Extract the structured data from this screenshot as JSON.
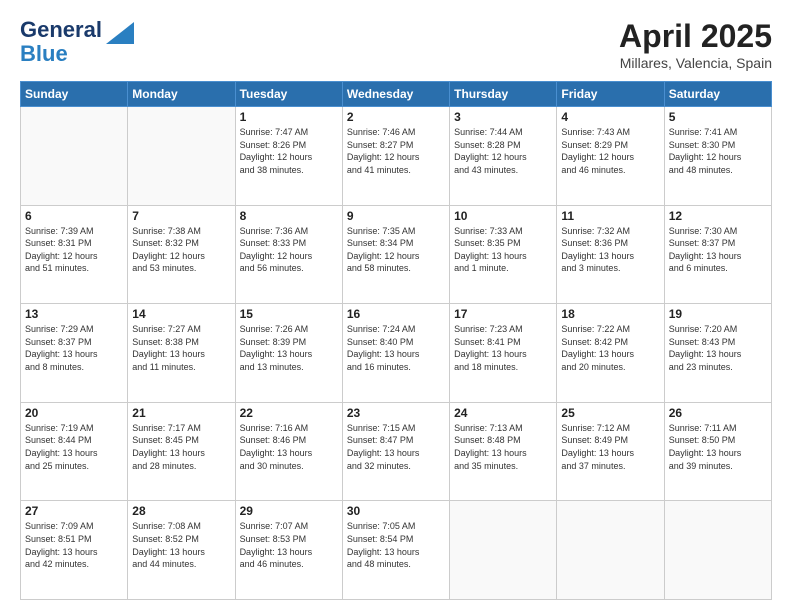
{
  "header": {
    "logo_line1": "General",
    "logo_line2": "Blue",
    "month_title": "April 2025",
    "location": "Millares, Valencia, Spain"
  },
  "weekdays": [
    "Sunday",
    "Monday",
    "Tuesday",
    "Wednesday",
    "Thursday",
    "Friday",
    "Saturday"
  ],
  "weeks": [
    [
      {
        "day": "",
        "info": ""
      },
      {
        "day": "",
        "info": ""
      },
      {
        "day": "1",
        "info": "Sunrise: 7:47 AM\nSunset: 8:26 PM\nDaylight: 12 hours\nand 38 minutes."
      },
      {
        "day": "2",
        "info": "Sunrise: 7:46 AM\nSunset: 8:27 PM\nDaylight: 12 hours\nand 41 minutes."
      },
      {
        "day": "3",
        "info": "Sunrise: 7:44 AM\nSunset: 8:28 PM\nDaylight: 12 hours\nand 43 minutes."
      },
      {
        "day": "4",
        "info": "Sunrise: 7:43 AM\nSunset: 8:29 PM\nDaylight: 12 hours\nand 46 minutes."
      },
      {
        "day": "5",
        "info": "Sunrise: 7:41 AM\nSunset: 8:30 PM\nDaylight: 12 hours\nand 48 minutes."
      }
    ],
    [
      {
        "day": "6",
        "info": "Sunrise: 7:39 AM\nSunset: 8:31 PM\nDaylight: 12 hours\nand 51 minutes."
      },
      {
        "day": "7",
        "info": "Sunrise: 7:38 AM\nSunset: 8:32 PM\nDaylight: 12 hours\nand 53 minutes."
      },
      {
        "day": "8",
        "info": "Sunrise: 7:36 AM\nSunset: 8:33 PM\nDaylight: 12 hours\nand 56 minutes."
      },
      {
        "day": "9",
        "info": "Sunrise: 7:35 AM\nSunset: 8:34 PM\nDaylight: 12 hours\nand 58 minutes."
      },
      {
        "day": "10",
        "info": "Sunrise: 7:33 AM\nSunset: 8:35 PM\nDaylight: 13 hours\nand 1 minute."
      },
      {
        "day": "11",
        "info": "Sunrise: 7:32 AM\nSunset: 8:36 PM\nDaylight: 13 hours\nand 3 minutes."
      },
      {
        "day": "12",
        "info": "Sunrise: 7:30 AM\nSunset: 8:37 PM\nDaylight: 13 hours\nand 6 minutes."
      }
    ],
    [
      {
        "day": "13",
        "info": "Sunrise: 7:29 AM\nSunset: 8:37 PM\nDaylight: 13 hours\nand 8 minutes."
      },
      {
        "day": "14",
        "info": "Sunrise: 7:27 AM\nSunset: 8:38 PM\nDaylight: 13 hours\nand 11 minutes."
      },
      {
        "day": "15",
        "info": "Sunrise: 7:26 AM\nSunset: 8:39 PM\nDaylight: 13 hours\nand 13 minutes."
      },
      {
        "day": "16",
        "info": "Sunrise: 7:24 AM\nSunset: 8:40 PM\nDaylight: 13 hours\nand 16 minutes."
      },
      {
        "day": "17",
        "info": "Sunrise: 7:23 AM\nSunset: 8:41 PM\nDaylight: 13 hours\nand 18 minutes."
      },
      {
        "day": "18",
        "info": "Sunrise: 7:22 AM\nSunset: 8:42 PM\nDaylight: 13 hours\nand 20 minutes."
      },
      {
        "day": "19",
        "info": "Sunrise: 7:20 AM\nSunset: 8:43 PM\nDaylight: 13 hours\nand 23 minutes."
      }
    ],
    [
      {
        "day": "20",
        "info": "Sunrise: 7:19 AM\nSunset: 8:44 PM\nDaylight: 13 hours\nand 25 minutes."
      },
      {
        "day": "21",
        "info": "Sunrise: 7:17 AM\nSunset: 8:45 PM\nDaylight: 13 hours\nand 28 minutes."
      },
      {
        "day": "22",
        "info": "Sunrise: 7:16 AM\nSunset: 8:46 PM\nDaylight: 13 hours\nand 30 minutes."
      },
      {
        "day": "23",
        "info": "Sunrise: 7:15 AM\nSunset: 8:47 PM\nDaylight: 13 hours\nand 32 minutes."
      },
      {
        "day": "24",
        "info": "Sunrise: 7:13 AM\nSunset: 8:48 PM\nDaylight: 13 hours\nand 35 minutes."
      },
      {
        "day": "25",
        "info": "Sunrise: 7:12 AM\nSunset: 8:49 PM\nDaylight: 13 hours\nand 37 minutes."
      },
      {
        "day": "26",
        "info": "Sunrise: 7:11 AM\nSunset: 8:50 PM\nDaylight: 13 hours\nand 39 minutes."
      }
    ],
    [
      {
        "day": "27",
        "info": "Sunrise: 7:09 AM\nSunset: 8:51 PM\nDaylight: 13 hours\nand 42 minutes."
      },
      {
        "day": "28",
        "info": "Sunrise: 7:08 AM\nSunset: 8:52 PM\nDaylight: 13 hours\nand 44 minutes."
      },
      {
        "day": "29",
        "info": "Sunrise: 7:07 AM\nSunset: 8:53 PM\nDaylight: 13 hours\nand 46 minutes."
      },
      {
        "day": "30",
        "info": "Sunrise: 7:05 AM\nSunset: 8:54 PM\nDaylight: 13 hours\nand 48 minutes."
      },
      {
        "day": "",
        "info": ""
      },
      {
        "day": "",
        "info": ""
      },
      {
        "day": "",
        "info": ""
      }
    ]
  ]
}
